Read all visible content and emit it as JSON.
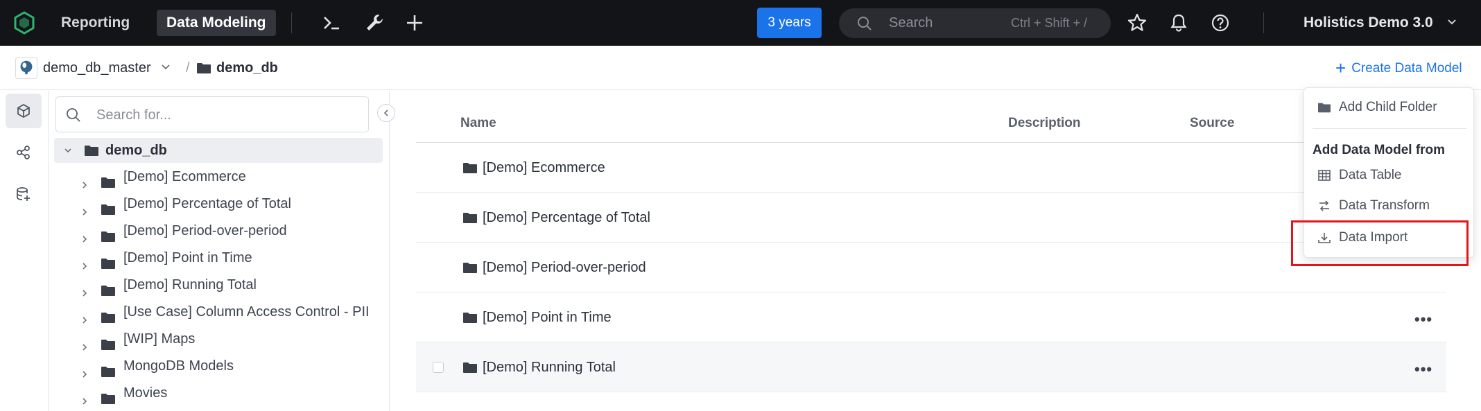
{
  "topbar": {
    "tabs": [
      {
        "label": "Reporting",
        "active": false
      },
      {
        "label": "Data Modeling",
        "active": true
      }
    ],
    "icons": [
      "terminal-icon",
      "wrench-icon",
      "plus-icon"
    ],
    "date_range_button": "3 years",
    "search": {
      "placeholder": "Search",
      "shortcut": "Ctrl + Shift + /"
    },
    "right_icons": [
      "star-icon",
      "bell-icon",
      "help-icon"
    ],
    "org_name": "Holistics Demo 3.0"
  },
  "breadcrumb": {
    "datasource": "demo_db_master",
    "separator": "/",
    "folder": "demo_db",
    "create_button": "Create Data Model"
  },
  "rail": {
    "items": [
      "cube-icon",
      "share-nodes-icon",
      "database-add-icon"
    ]
  },
  "tree": {
    "search_placeholder": "Search for...",
    "root": "demo_db",
    "items": [
      "[Demo] Ecommerce",
      "[Demo] Percentage of Total",
      "[Demo] Period-over-period",
      "[Demo] Point in Time",
      "[Demo] Running Total",
      "[Use Case] Column Access Control - PII",
      "[WIP] Maps",
      "MongoDB Models",
      "Movies"
    ]
  },
  "table": {
    "headers": {
      "name": "Name",
      "description": "Description",
      "source": "Source"
    },
    "rows": [
      "[Demo] Ecommerce",
      "[Demo] Percentage of Total",
      "[Demo] Period-over-period",
      "[Demo] Point in Time",
      "[Demo] Running Total"
    ]
  },
  "menu": {
    "add_child_folder": "Add Child Folder",
    "section_title": "Add Data Model from",
    "data_table": "Data Table",
    "data_transform": "Data Transform",
    "data_import": "Data Import"
  },
  "colors": {
    "topbar_bg": "#131417",
    "accent": "#1a73e8",
    "highlight": "#e0161b"
  }
}
